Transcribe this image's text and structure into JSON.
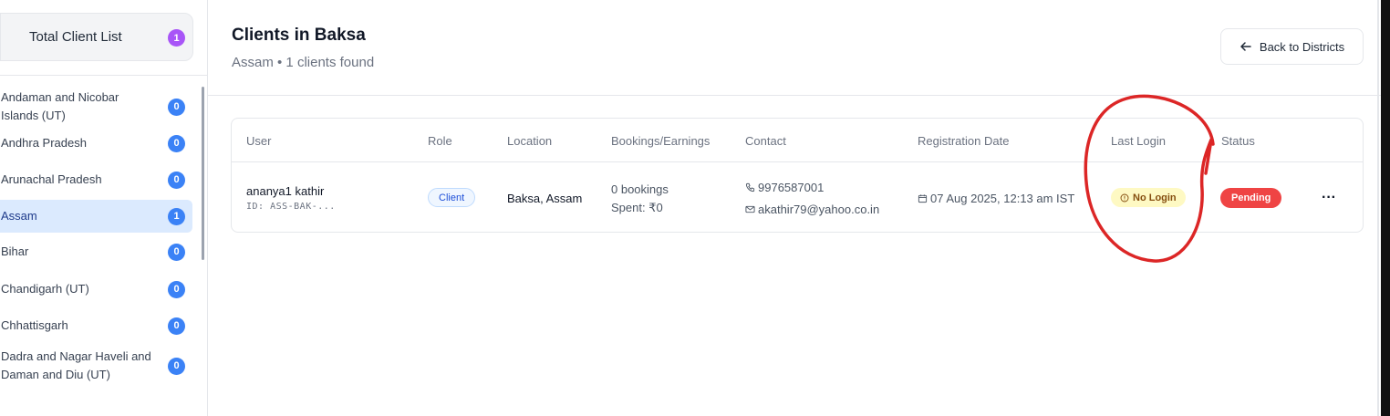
{
  "sidebar": {
    "total_label": "Total Client List",
    "total_count": "1",
    "states": [
      {
        "name": "Andaman and Nicobar Islands (UT)",
        "count": "0"
      },
      {
        "name": "Andhra Pradesh",
        "count": "0"
      },
      {
        "name": "Arunachal Pradesh",
        "count": "0"
      },
      {
        "name": "Assam",
        "count": "1"
      },
      {
        "name": "Bihar",
        "count": "0"
      },
      {
        "name": "Chandigarh (UT)",
        "count": "0"
      },
      {
        "name": "Chhattisgarh",
        "count": "0"
      },
      {
        "name": "Dadra and Nagar Haveli and Daman and Diu (UT)",
        "count": "0"
      }
    ]
  },
  "header": {
    "title": "Clients in Baksa",
    "subtitle": "Assam • 1 clients found",
    "back_label": "Back to Districts"
  },
  "table": {
    "columns": [
      "User",
      "Role",
      "Location",
      "Bookings/Earnings",
      "Contact",
      "Registration Date",
      "Last Login",
      "Status"
    ],
    "rows": [
      {
        "user_name": "ananya1 kathir",
        "user_id": "ID: ASS-BAK-...",
        "role": "Client",
        "location": "Baksa, Assam",
        "bookings": "0 bookings",
        "spent": "Spent: ₹0",
        "phone": "9976587001",
        "email": "akathir79@yahoo.co.in",
        "registration": "07 Aug 2025, 12:13 am IST",
        "last_login": "No Login",
        "status": "Pending",
        "more": "···"
      }
    ]
  },
  "colors": {
    "accent_purple": "#a855f7",
    "badge_blue": "#3b82f6",
    "active_bg": "#dbeafe",
    "pending_red": "#ef4444",
    "nologin_bg": "#fef9c3",
    "annotation_red": "#dc2626"
  },
  "icons": {
    "back": "arrow-left-icon",
    "phone": "phone-icon",
    "email": "mail-icon",
    "calendar": "calendar-icon",
    "clock": "clock-icon",
    "more": "more-horizontal-icon"
  }
}
